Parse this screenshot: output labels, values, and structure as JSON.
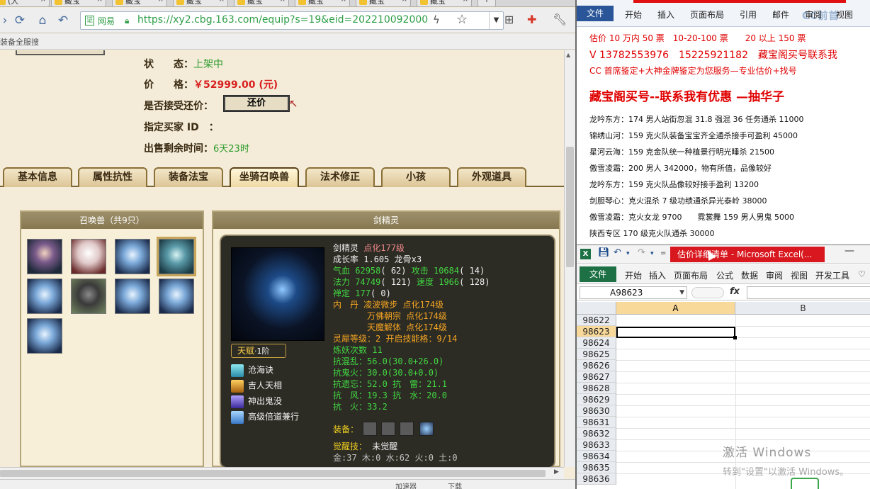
{
  "browser": {
    "tabs": [
      {
        "label": "(大"
      },
      {
        "label": "藏宝"
      },
      {
        "label": "藏宝"
      },
      {
        "label": "藏宝"
      },
      {
        "label": "藏宝"
      },
      {
        "label": "藏宝"
      },
      {
        "label": "藏宝"
      },
      {
        "label": "藏宝"
      }
    ],
    "new_tab": "+",
    "url": "https://xy2.cbg.163.com/equip?s=19&eid=202210092000213-",
    "cert_label": "网易",
    "bookmark_item": "装备全服搜",
    "status_items": [
      "加速器",
      "下载"
    ]
  },
  "listing": {
    "status_label": "状　　态：",
    "status_value": "上架中",
    "price_label": "价　　格：",
    "price_value": "￥52999.00 (元)",
    "counter_label": "是否接受还价：",
    "counter_button": "还价",
    "buyer_label": "指定买家 ID　：",
    "remaining_label": "出售剩余时间：",
    "remaining_value": "6天23时"
  },
  "page_tabs": [
    "基本信息",
    "属性抗性",
    "装备法宝",
    "坐骑召唤兽",
    "法术修正",
    "小孩",
    "外观道具"
  ],
  "active_tab": "坐骑召唤兽",
  "pets": {
    "header": "召唤兽（共9只）",
    "selected_index": 3
  },
  "pet_detail": {
    "header": "剑精灵",
    "name": "剑精灵",
    "level": "点化177级",
    "growth_label": "成长率",
    "growth_value": "1.605",
    "bone_label": "龙骨x3",
    "hp_label": "气血",
    "hp_value": "62958",
    "hp_points": "( 62)",
    "atk_label": "攻击",
    "atk_value": "10684",
    "atk_points": "( 14)",
    "mp_label": "法力",
    "mp_value": "74749",
    "mp_points": "( 121)",
    "spd_label": "速度",
    "spd_value": "1966",
    "spd_points": "( 128)",
    "zen_label": "禅定",
    "zen_value": "177",
    "zen_points": "( 0)",
    "dan_label": "内　丹",
    "dan1": "凌波微步 点化174级",
    "dan2": "万佛朝宗 点化174级",
    "dan3": "天魔解体 点化174级",
    "lingxi": "灵犀等级：2 开启技能格：9/14",
    "lianyao": "炼妖次数 11",
    "res1": "抗混乱：56.0(30.0+26.0)",
    "res2": "抗鬼火：30.0(30.0+0.0)",
    "res3": "抗遗忘：52.0 抗　雷：21.1",
    "res4": "抗　风：19.3 抗　水：20.0",
    "res5": "抗　火：33.2",
    "equip_label": "装备：",
    "awaken_label": "觉醒技：",
    "awaken_value": "未觉醒",
    "elements": "金:37 木:0 水:62 火:0 土:0",
    "talent_label": "天赋",
    "talent_level": "·1阶",
    "skills": [
      "沧海诀",
      "吉人天相",
      "神出鬼没",
      "高级倍道兼行"
    ]
  },
  "word": {
    "file_tab": "文件",
    "menus": [
      "开始",
      "插入",
      "页面布局",
      "引用",
      "邮件",
      "审阅",
      "视图"
    ],
    "badge": "CC前首",
    "lines": [
      "估价 10 万内 50 票　10-20-100 票　　20 以上 150 票",
      "V 13782553976　15225921182　藏宝阁买号联系我",
      "CC 首席鉴定+大神金牌鉴定为您服务—专业估价+找号",
      "藏宝阁买号--联系我有优惠 —抽华子",
      "龙吟东方：174 男人站街忽混 31.8 强混 36 任务通杀 11000",
      "锦绣山河：159 克火队装备宝宝齐全通杀接手可盈利 45000",
      "星河云海：159 克金队统一种植景行明光睡杀 21500",
      "傲雪凌霜：200 男人 342000，物有所值，品像较好",
      "龙吟东方：159 克火队品像较好接手盈利 13200",
      "剑胆琴心：克火混杀 7 级功绩通杀异光泰岭 38000",
      "傲雪凌霜：克火女龙 9700　　霓裳舞 159 男人男鬼 5000",
      "陕西专区 170 级克火队通杀 30000"
    ]
  },
  "excel": {
    "title": "估价详细清单 - Microsoft Excel(...",
    "file_tab": "文件",
    "menus": [
      "开始",
      "插入",
      "页面布局",
      "公式",
      "数据",
      "审阅",
      "视图",
      "开发工具"
    ],
    "name_box": "A98623",
    "fx": "fx",
    "columns": [
      "A",
      "B"
    ],
    "rows": [
      "98622",
      "98623",
      "98624",
      "98625",
      "98626",
      "98627",
      "98628",
      "98629",
      "98630",
      "98631",
      "98632",
      "98633",
      "98634",
      "98635",
      "98636"
    ],
    "active_row": "98623",
    "watermark_title": "激活 Windows",
    "watermark_sub": "转到\"设置\"以激活 Windows。"
  }
}
